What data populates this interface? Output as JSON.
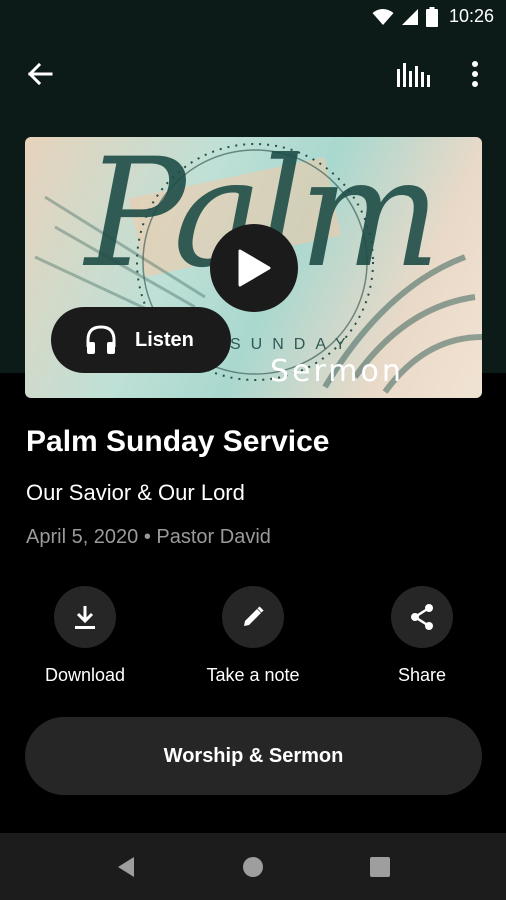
{
  "status_bar": {
    "time": "10:26"
  },
  "app_bar": {
    "back_icon": "arrow-back-icon",
    "equalizer_icon": "equalizer-icon",
    "more_icon": "more-vert-icon"
  },
  "artwork": {
    "script_word": "Palm",
    "sub_word": "SUNDAY",
    "word": "Sermon"
  },
  "player": {
    "listen_label": "Listen"
  },
  "sermon": {
    "title": "Palm Sunday Service",
    "subtitle": "Our Savior & Our Lord",
    "meta": "April 5, 2020 • Pastor David"
  },
  "actions": [
    {
      "label": "Download",
      "icon": "download-icon"
    },
    {
      "label": "Take a note",
      "icon": "pencil-icon"
    },
    {
      "label": "Share",
      "icon": "share-icon"
    }
  ],
  "series_button": {
    "label": "Worship & Sermon"
  },
  "colors": {
    "top_background": "#0c1a18",
    "surface": "#262626",
    "secondary_text": "#9a9a9a"
  }
}
